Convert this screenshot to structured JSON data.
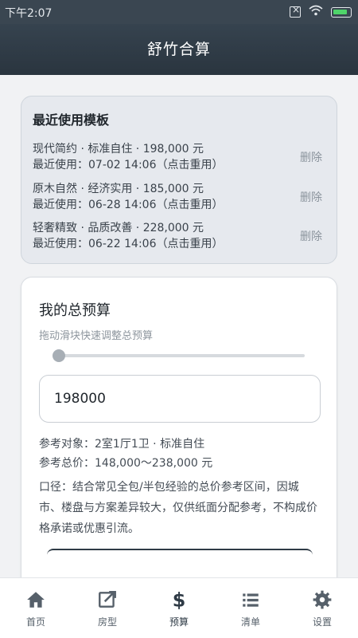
{
  "statusbar": {
    "time": "下午2:07"
  },
  "header": {
    "title": "舒竹合算"
  },
  "recent": {
    "title": "最近使用模板",
    "items": [
      {
        "line1": "现代简约 · 标准自住 · 198,000 元",
        "line2": "最近使用：07-02 14:06（点击重用）",
        "delete": "删除"
      },
      {
        "line1": "原木自然 · 经济实用 · 185,000 元",
        "line2": "最近使用：06-28 14:06（点击重用）",
        "delete": "删除"
      },
      {
        "line1": "轻奢精致 · 品质改善 · 228,000 元",
        "line2": "最近使用：06-22 14:06（点击重用）",
        "delete": "删除"
      }
    ]
  },
  "budget": {
    "title": "我的总预算",
    "hint": "拖动滑块快速调整总预算",
    "slider_level": 0,
    "value": "198000",
    "ref_target": "参考对象：2室1厅1卫 · 标准自住",
    "ref_total": "参考总价：148,000～238,000 元",
    "note": "口径：结合常见全包/半包经验的总价参考区间，因城市、楼盘与方案差异较大，仅供纸面分配参考，不构成价格承诺或优惠引流。"
  },
  "nav": {
    "items": [
      {
        "label": "首页",
        "icon": "home-icon"
      },
      {
        "label": "房型",
        "icon": "edit-icon"
      },
      {
        "label": "预算",
        "icon": "dollar-icon"
      },
      {
        "label": "清单",
        "icon": "list-icon"
      },
      {
        "label": "设置",
        "icon": "gear-icon"
      }
    ],
    "active": "预算"
  },
  "colors": {
    "header": "#2f3b46",
    "background": "#f1f2f4",
    "recent_card": "#e6e9ee"
  }
}
